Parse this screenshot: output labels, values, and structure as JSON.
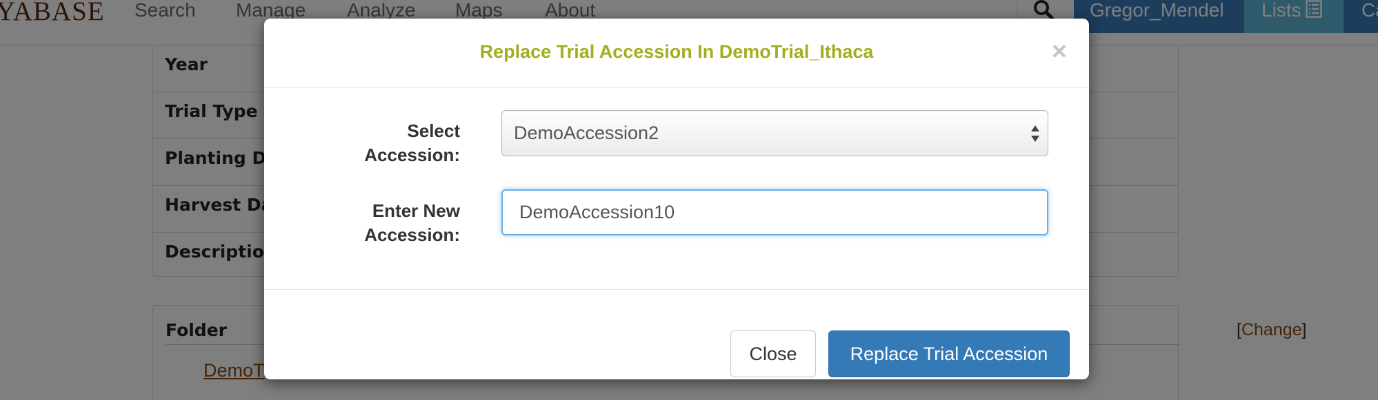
{
  "nav": {
    "brand": "YABASE",
    "links": [
      "Search",
      "Manage",
      "Analyze",
      "Maps",
      "About"
    ],
    "user": "Gregor_Mendel",
    "lists": "Lists",
    "cart": "Ca"
  },
  "trial_info": {
    "rows": [
      "Year",
      "Trial Type",
      "Planting Da",
      "Harvest Da",
      "Descriptior"
    ]
  },
  "folder": {
    "label": "Folder",
    "change_open": "[",
    "change_link": "Change",
    "change_close": "]",
    "name": "DemoT"
  },
  "modal": {
    "title": "Replace Trial Accession In DemoTrial_Ithaca",
    "close_symbol": "×",
    "select_label_line1": "Select",
    "select_label_line2": "Accession:",
    "select_value": "DemoAccession2",
    "new_label_line1": "Enter New",
    "new_label_line2": "Accession:",
    "new_value": "DemoAccession10",
    "close_button": "Close",
    "replace_button": "Replace Trial Accession"
  },
  "colors": {
    "title": "#a3ad20",
    "primary": "#337ab7",
    "user_nav": "#3b7ab8",
    "lists_nav": "#5fb4d9",
    "link": "#8a4a12"
  }
}
